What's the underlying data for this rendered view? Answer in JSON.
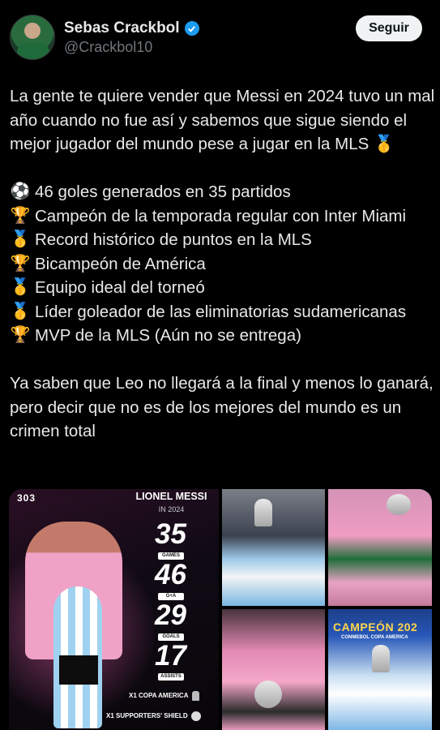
{
  "header": {
    "display_name": "Sebas Crackbol",
    "handle": "@Crackbol10",
    "follow_label": "Seguir",
    "verified_color": "#1d9bf0"
  },
  "tweet": {
    "paragraph1": "La gente te quiere vender que Messi en 2024 tuvo un mal año cuando no fue así y sabemos que sigue siendo el mejor jugador del mundo pese a jugar en la MLS",
    "paragraph1_emoji": "🥇",
    "items": [
      {
        "emoji": "⚽",
        "text": "46 goles generados en 35 partidos"
      },
      {
        "emoji": "🏆",
        "text": "Campeón de la temporada regular con Inter Miami"
      },
      {
        "emoji": "🥇",
        "text": "Record histórico de puntos en la MLS"
      },
      {
        "emoji": "🏆",
        "text": "Bicampeón de América"
      },
      {
        "emoji": "🥇",
        "text": "Equipo ideal del torneó"
      },
      {
        "emoji": "🥇",
        "text": "Líder goleador de las eliminatorias sudamericanas"
      },
      {
        "emoji": "🏆",
        "text": "MVP de la MLS (Aún no se entrega)"
      }
    ],
    "paragraph3": "Ya saben que Leo no llegará a la final y menos lo ganará, pero decir que no es de los mejores del mundo es un crimen total"
  },
  "media": {
    "stats_card": {
      "brand": "303",
      "player": "LIONEL MESSI",
      "year": "IN 2024",
      "stats": [
        {
          "value": "35",
          "label": "GAMES"
        },
        {
          "value": "46",
          "label": "G+A"
        },
        {
          "value": "29",
          "label": "GOALS"
        },
        {
          "value": "17",
          "label": "ASSISTS"
        }
      ],
      "trophies": [
        "X1 COPA AMERICA",
        "X1 SUPPORTERS' SHIELD"
      ]
    },
    "collage": {
      "banner_title": "CAMPEÓN 202",
      "banner_sub": "CONMEBOL COPA AMERICA"
    }
  }
}
